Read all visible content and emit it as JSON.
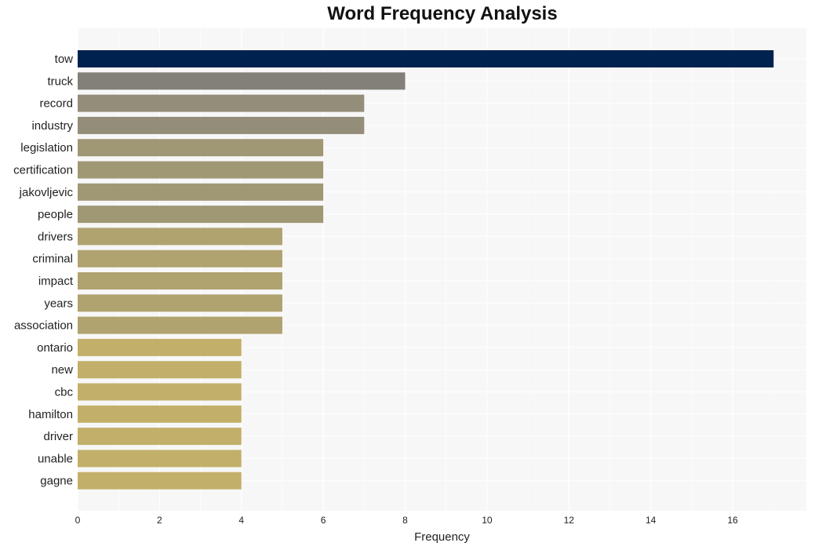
{
  "chart_data": {
    "type": "bar",
    "orientation": "horizontal",
    "title": "Word Frequency Analysis",
    "xlabel": "Frequency",
    "ylabel": "",
    "xlim": [
      0,
      17.8
    ],
    "xticks": [
      0,
      2,
      4,
      6,
      8,
      10,
      12,
      14,
      16
    ],
    "grid": true,
    "categories": [
      "tow",
      "truck",
      "record",
      "industry",
      "legislation",
      "certification",
      "jakovljevic",
      "people",
      "drivers",
      "criminal",
      "impact",
      "years",
      "association",
      "ontario",
      "new",
      "cbc",
      "hamilton",
      "driver",
      "unable",
      "gagne"
    ],
    "values": [
      17,
      8,
      7,
      7,
      6,
      6,
      6,
      6,
      5,
      5,
      5,
      5,
      5,
      4,
      4,
      4,
      4,
      4,
      4,
      4
    ],
    "colors": {
      "17": "#00224e",
      "8": "#838079",
      "7": "#948d79",
      "6": "#a09775",
      "5": "#b0a370",
      "4": "#c2b06a"
    },
    "background": "#f7f7f7",
    "gridline_color": "#ffffff"
  }
}
